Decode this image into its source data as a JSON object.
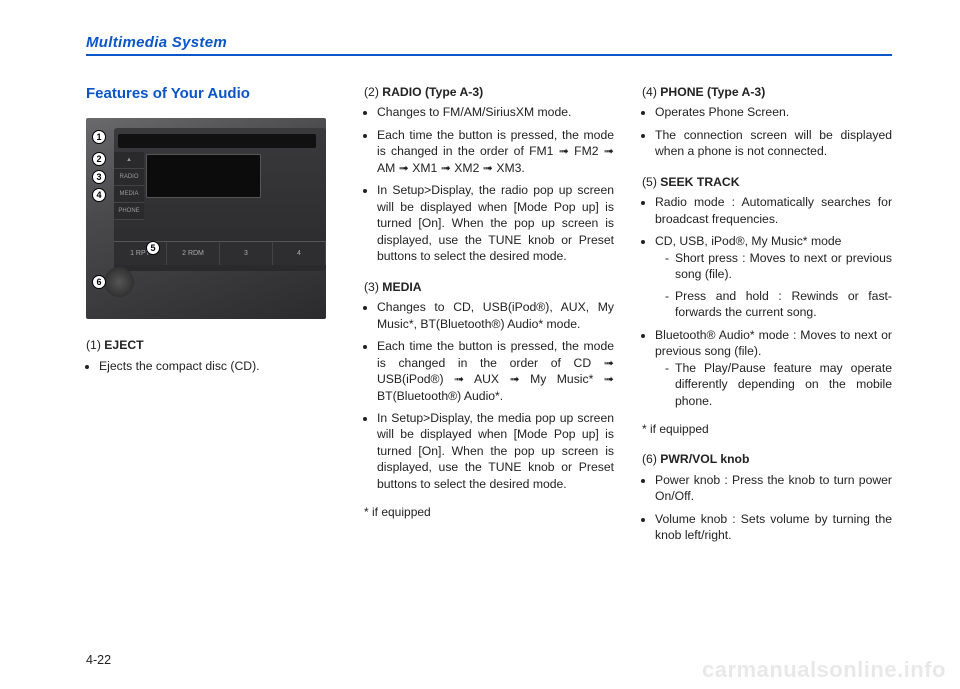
{
  "header": {
    "chapter": "Multimedia System"
  },
  "pageNumber": "4-22",
  "watermark": "carmanualsonline.info",
  "sectionTitle": "Features of Your Audio",
  "photo": {
    "buttons": {
      "b1": "RADIO",
      "b2": "MEDIA",
      "b3": "PHONE"
    },
    "row": {
      "r1": "1 RPT",
      "r2": "2 RDM",
      "r3": "3",
      "r4": "4"
    }
  },
  "items": [
    {
      "num": "(1)",
      "name": "EJECT",
      "bullets": [
        "Ejects the compact disc (CD)."
      ]
    },
    {
      "num": "(2)",
      "name": "RADIO (Type A-3)",
      "bullets": [
        "Changes to FM/AM/SiriusXM mode.",
        "Each time the button is pressed, the mode is changed in the order of FM1 ➟ FM2 ➟ AM ➟ XM1 ➟ XM2 ➟ XM3.",
        "In Setup>Display, the radio pop up screen will be displayed when [Mode Pop up] is turned [On]. When the pop up screen is displayed, use the TUNE knob or Preset buttons to select the desired mode."
      ]
    },
    {
      "num": "(3)",
      "name": "MEDIA",
      "bullets": [
        "Changes to CD, USB(iPod®), AUX, My Music*, BT(Bluetooth®) Audio* mode.",
        "Each time the button is pressed, the mode is changed in the order of CD ➟ USB(iPod®) ➟ AUX ➟ My Music* ➟ BT(Bluetooth®) Audio*.",
        "In Setup>Display, the media pop up screen will be displayed when [Mode Pop up] is turned [On]. When the pop up screen is displayed, use the TUNE knob or Preset buttons to select the desired mode."
      ],
      "note": "* if equipped"
    },
    {
      "num": "(4)",
      "name": "PHONE (Type A-3)",
      "bullets": [
        "Operates Phone Screen.",
        "The connection screen will be displayed when a phone is not connected."
      ]
    },
    {
      "num": "(5)",
      "name": "SEEK TRACK",
      "bullets": [
        "Radio mode : Automatically searches for broadcast frequencies.",
        "CD, USB, iPod®, My Music* mode",
        "Bluetooth® Audio* mode : Moves to next or previous song (file)."
      ],
      "sub1": [
        "Short press : Moves to next or previous song (file).",
        "Press and hold : Rewinds or fast-forwards the current song."
      ],
      "sub2": [
        "The Play/Pause feature may operate differently depending on the mobile phone."
      ],
      "note": "* if equipped"
    },
    {
      "num": "(6)",
      "name": "PWR/VOL knob",
      "bullets": [
        "Power knob : Press the knob to turn power On/Off.",
        "Volume knob : Sets volume by turning the knob left/right."
      ]
    }
  ]
}
